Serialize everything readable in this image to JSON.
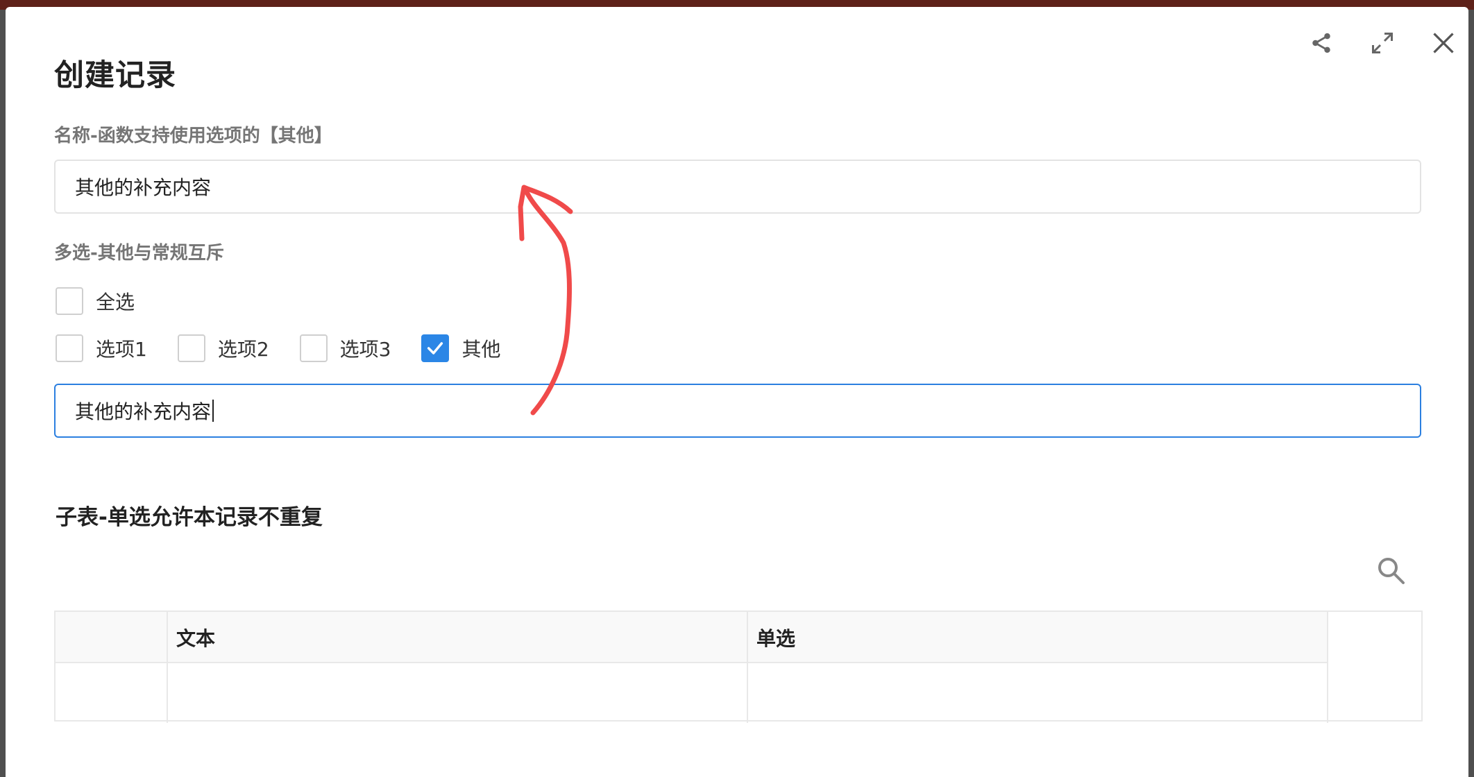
{
  "modal": {
    "title": "创建记录",
    "icons": [
      "share-icon",
      "expand-icon",
      "close-icon"
    ]
  },
  "fields": {
    "name": {
      "label": "名称-函数支持使用选项的【其他】",
      "value": "其他的补充内容"
    },
    "multiselect": {
      "label": "多选-其他与常规互斥",
      "select_all": "全选",
      "options": [
        {
          "label": "选项1",
          "checked": false
        },
        {
          "label": "选项2",
          "checked": false
        },
        {
          "label": "选项3",
          "checked": false
        },
        {
          "label": "其他",
          "checked": true
        }
      ],
      "other_value": "其他的补充内容"
    }
  },
  "subtable": {
    "title": "子表-单选允许本记录不重复",
    "columns": [
      "文本",
      "单选"
    ]
  },
  "colors": {
    "accent": "#2b86e6",
    "annotation": "#f04a4a"
  }
}
